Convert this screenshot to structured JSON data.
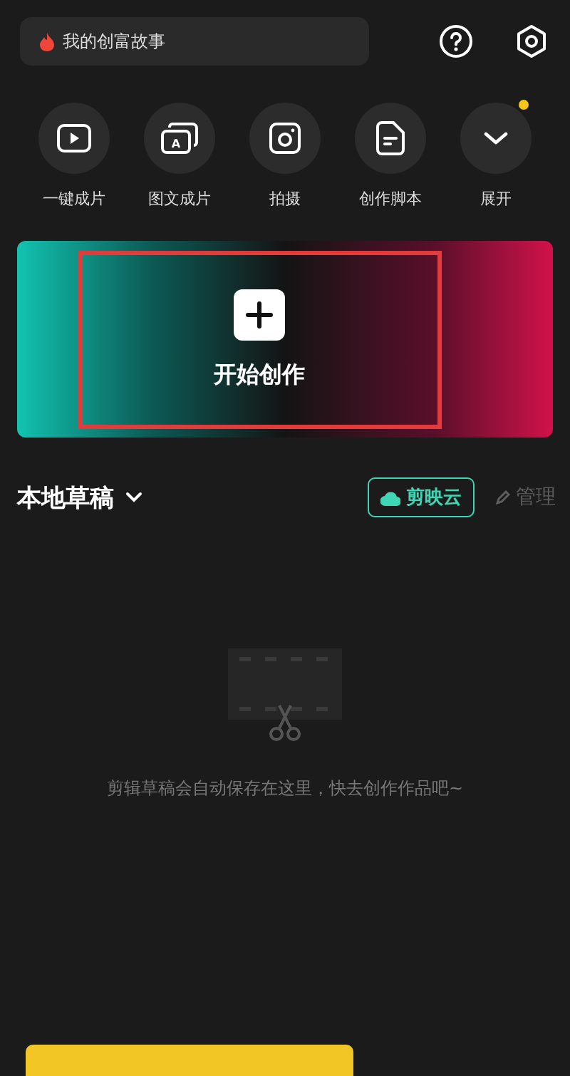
{
  "search": {
    "placeholder": "我的创富故事"
  },
  "tools": [
    {
      "kind": "video",
      "label": "一键成片",
      "badge": false
    },
    {
      "kind": "gallery",
      "label": "图文成片",
      "badge": false,
      "glyph": "A"
    },
    {
      "kind": "camera",
      "label": "拍摄",
      "badge": false
    },
    {
      "kind": "script",
      "label": "创作脚本",
      "badge": false
    },
    {
      "kind": "expand",
      "label": "展开",
      "badge": true
    }
  ],
  "create": {
    "label": "开始创作",
    "highlighted": true
  },
  "drafts": {
    "title": "本地草稿",
    "cloud_button": "剪映云",
    "manage_button": {
      "label": "管理",
      "disabled": true
    },
    "empty_text": "剪辑草稿会自动保存在这里，快去创作作品吧~"
  }
}
